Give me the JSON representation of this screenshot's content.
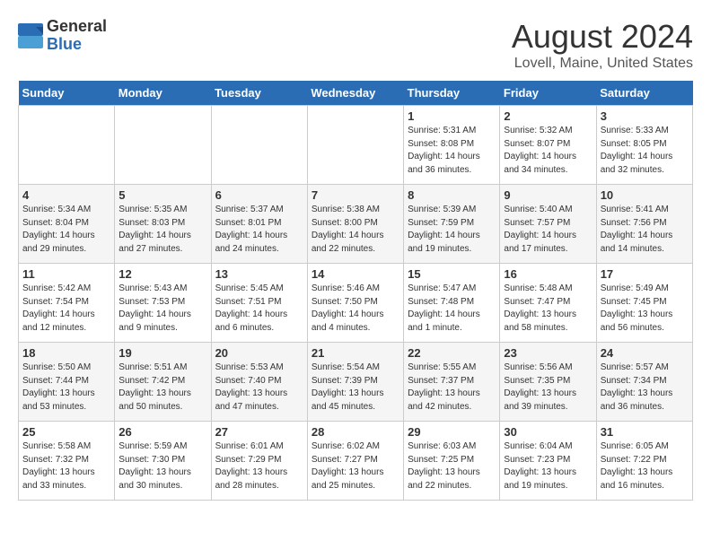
{
  "header": {
    "logo_line1": "General",
    "logo_line2": "Blue",
    "month_title": "August 2024",
    "location": "Lovell, Maine, United States"
  },
  "days_of_week": [
    "Sunday",
    "Monday",
    "Tuesday",
    "Wednesday",
    "Thursday",
    "Friday",
    "Saturday"
  ],
  "weeks": [
    [
      {
        "day": "",
        "info": ""
      },
      {
        "day": "",
        "info": ""
      },
      {
        "day": "",
        "info": ""
      },
      {
        "day": "",
        "info": ""
      },
      {
        "day": "1",
        "info": "Sunrise: 5:31 AM\nSunset: 8:08 PM\nDaylight: 14 hours\nand 36 minutes."
      },
      {
        "day": "2",
        "info": "Sunrise: 5:32 AM\nSunset: 8:07 PM\nDaylight: 14 hours\nand 34 minutes."
      },
      {
        "day": "3",
        "info": "Sunrise: 5:33 AM\nSunset: 8:05 PM\nDaylight: 14 hours\nand 32 minutes."
      }
    ],
    [
      {
        "day": "4",
        "info": "Sunrise: 5:34 AM\nSunset: 8:04 PM\nDaylight: 14 hours\nand 29 minutes."
      },
      {
        "day": "5",
        "info": "Sunrise: 5:35 AM\nSunset: 8:03 PM\nDaylight: 14 hours\nand 27 minutes."
      },
      {
        "day": "6",
        "info": "Sunrise: 5:37 AM\nSunset: 8:01 PM\nDaylight: 14 hours\nand 24 minutes."
      },
      {
        "day": "7",
        "info": "Sunrise: 5:38 AM\nSunset: 8:00 PM\nDaylight: 14 hours\nand 22 minutes."
      },
      {
        "day": "8",
        "info": "Sunrise: 5:39 AM\nSunset: 7:59 PM\nDaylight: 14 hours\nand 19 minutes."
      },
      {
        "day": "9",
        "info": "Sunrise: 5:40 AM\nSunset: 7:57 PM\nDaylight: 14 hours\nand 17 minutes."
      },
      {
        "day": "10",
        "info": "Sunrise: 5:41 AM\nSunset: 7:56 PM\nDaylight: 14 hours\nand 14 minutes."
      }
    ],
    [
      {
        "day": "11",
        "info": "Sunrise: 5:42 AM\nSunset: 7:54 PM\nDaylight: 14 hours\nand 12 minutes."
      },
      {
        "day": "12",
        "info": "Sunrise: 5:43 AM\nSunset: 7:53 PM\nDaylight: 14 hours\nand 9 minutes."
      },
      {
        "day": "13",
        "info": "Sunrise: 5:45 AM\nSunset: 7:51 PM\nDaylight: 14 hours\nand 6 minutes."
      },
      {
        "day": "14",
        "info": "Sunrise: 5:46 AM\nSunset: 7:50 PM\nDaylight: 14 hours\nand 4 minutes."
      },
      {
        "day": "15",
        "info": "Sunrise: 5:47 AM\nSunset: 7:48 PM\nDaylight: 14 hours\nand 1 minute."
      },
      {
        "day": "16",
        "info": "Sunrise: 5:48 AM\nSunset: 7:47 PM\nDaylight: 13 hours\nand 58 minutes."
      },
      {
        "day": "17",
        "info": "Sunrise: 5:49 AM\nSunset: 7:45 PM\nDaylight: 13 hours\nand 56 minutes."
      }
    ],
    [
      {
        "day": "18",
        "info": "Sunrise: 5:50 AM\nSunset: 7:44 PM\nDaylight: 13 hours\nand 53 minutes."
      },
      {
        "day": "19",
        "info": "Sunrise: 5:51 AM\nSunset: 7:42 PM\nDaylight: 13 hours\nand 50 minutes."
      },
      {
        "day": "20",
        "info": "Sunrise: 5:53 AM\nSunset: 7:40 PM\nDaylight: 13 hours\nand 47 minutes."
      },
      {
        "day": "21",
        "info": "Sunrise: 5:54 AM\nSunset: 7:39 PM\nDaylight: 13 hours\nand 45 minutes."
      },
      {
        "day": "22",
        "info": "Sunrise: 5:55 AM\nSunset: 7:37 PM\nDaylight: 13 hours\nand 42 minutes."
      },
      {
        "day": "23",
        "info": "Sunrise: 5:56 AM\nSunset: 7:35 PM\nDaylight: 13 hours\nand 39 minutes."
      },
      {
        "day": "24",
        "info": "Sunrise: 5:57 AM\nSunset: 7:34 PM\nDaylight: 13 hours\nand 36 minutes."
      }
    ],
    [
      {
        "day": "25",
        "info": "Sunrise: 5:58 AM\nSunset: 7:32 PM\nDaylight: 13 hours\nand 33 minutes."
      },
      {
        "day": "26",
        "info": "Sunrise: 5:59 AM\nSunset: 7:30 PM\nDaylight: 13 hours\nand 30 minutes."
      },
      {
        "day": "27",
        "info": "Sunrise: 6:01 AM\nSunset: 7:29 PM\nDaylight: 13 hours\nand 28 minutes."
      },
      {
        "day": "28",
        "info": "Sunrise: 6:02 AM\nSunset: 7:27 PM\nDaylight: 13 hours\nand 25 minutes."
      },
      {
        "day": "29",
        "info": "Sunrise: 6:03 AM\nSunset: 7:25 PM\nDaylight: 13 hours\nand 22 minutes."
      },
      {
        "day": "30",
        "info": "Sunrise: 6:04 AM\nSunset: 7:23 PM\nDaylight: 13 hours\nand 19 minutes."
      },
      {
        "day": "31",
        "info": "Sunrise: 6:05 AM\nSunset: 7:22 PM\nDaylight: 13 hours\nand 16 minutes."
      }
    ]
  ]
}
